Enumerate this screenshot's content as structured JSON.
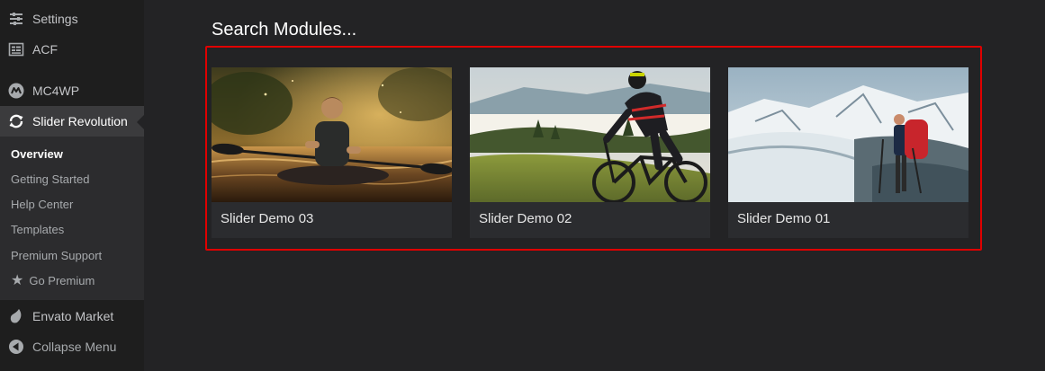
{
  "sidebar": {
    "items": [
      {
        "label": "Settings",
        "icon": "settings-icon"
      },
      {
        "label": "ACF",
        "icon": "acf-icon"
      },
      {
        "label": "MC4WP",
        "icon": "mc4wp-icon"
      },
      {
        "label": "Slider Revolution",
        "icon": "slider-revolution-icon"
      }
    ],
    "submenu": [
      {
        "label": "Overview"
      },
      {
        "label": "Getting Started"
      },
      {
        "label": "Help Center"
      },
      {
        "label": "Templates"
      },
      {
        "label": "Premium Support"
      },
      {
        "label": "Go Premium",
        "icon": "star-icon"
      }
    ],
    "bottom": [
      {
        "label": "Envato Market",
        "icon": "envato-leaf-icon"
      },
      {
        "label": "Collapse Menu",
        "icon": "collapse-arrow-icon"
      }
    ]
  },
  "main": {
    "title": "Search Modules...",
    "modules": [
      {
        "name": "Slider Demo 03",
        "image": "kayaker-at-sunset-image"
      },
      {
        "name": "Slider Demo 02",
        "image": "mountain-cyclist-image"
      },
      {
        "name": "Slider Demo 01",
        "image": "snowy-mountain-hiker-image"
      }
    ]
  },
  "colors": {
    "background": "#232325",
    "sidebar": "#1e1e1e",
    "submenu": "#2c2c2e",
    "card": "#2b2c2f",
    "highlight_border": "#e00000"
  }
}
